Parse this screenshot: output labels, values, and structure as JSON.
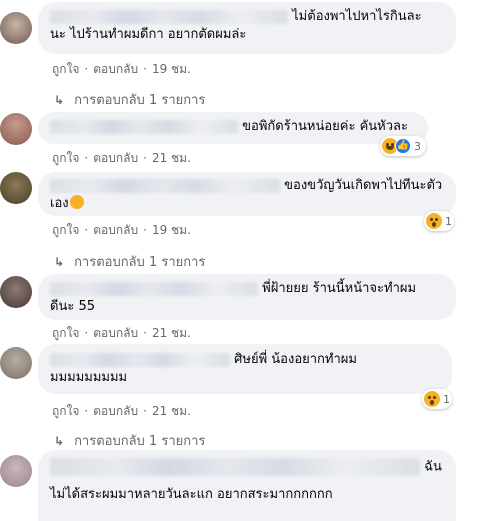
{
  "colors": {
    "bubble": "#f0f2f5",
    "meta_text": "#65676b",
    "like_blue": "#1877f2",
    "reaction_yellow": "#f7b125"
  },
  "comments": [
    {
      "line1": "ไม่ต้องพาไปหาไรกินละ",
      "line2": "นะ ไปร้านทำผมดีกา อยากตัดผมล่ะ",
      "like": "ถูกใจ",
      "reply": "ตอบกลับ",
      "time": "19 ชม.",
      "replies": "การตอบกลับ 1 รายการ"
    },
    {
      "line1": "ขอพิกัดร้านหน่อยค่ะ คันหัวละ",
      "like": "ถูกใจ",
      "reply": "ตอบกลับ",
      "time": "21 ชม.",
      "reaction_count": "3",
      "reaction_icons": [
        "haha-emoji-icon",
        "like-emoji-icon"
      ]
    },
    {
      "line1": "ของขวัญวันเกิดพาไปทีนะตัว",
      "line2": "เอง",
      "like": "ถูกใจ",
      "reply": "ตอบกลับ",
      "time": "19 ชม.",
      "replies": "การตอบกลับ 1 รายการ",
      "reaction_count": "1",
      "reaction_icons": [
        "wow-emoji-icon"
      ]
    },
    {
      "line1": "พี่ฝ้ายยย ร้านนี้หน้าจะทำผม",
      "line2": "ดีนะ 55",
      "like": "ถูกใจ",
      "reply": "ตอบกลับ",
      "time": "21 ชม."
    },
    {
      "line1": "ศิษย์พี่ น้องอยากทำผม",
      "line2": "มมมมมมมมม",
      "like": "ถูกใจ",
      "reply": "ตอบกลับ",
      "time": "21 ชม.",
      "replies": "การตอบกลับ 1 รายการ",
      "reaction_count": "1",
      "reaction_icons": [
        "wow-emoji-icon"
      ]
    },
    {
      "line1": "ฉัน",
      "line2": "ไม่ได้สระผมมาหลายวันละแก อยากสระมากกกกกก"
    }
  ]
}
